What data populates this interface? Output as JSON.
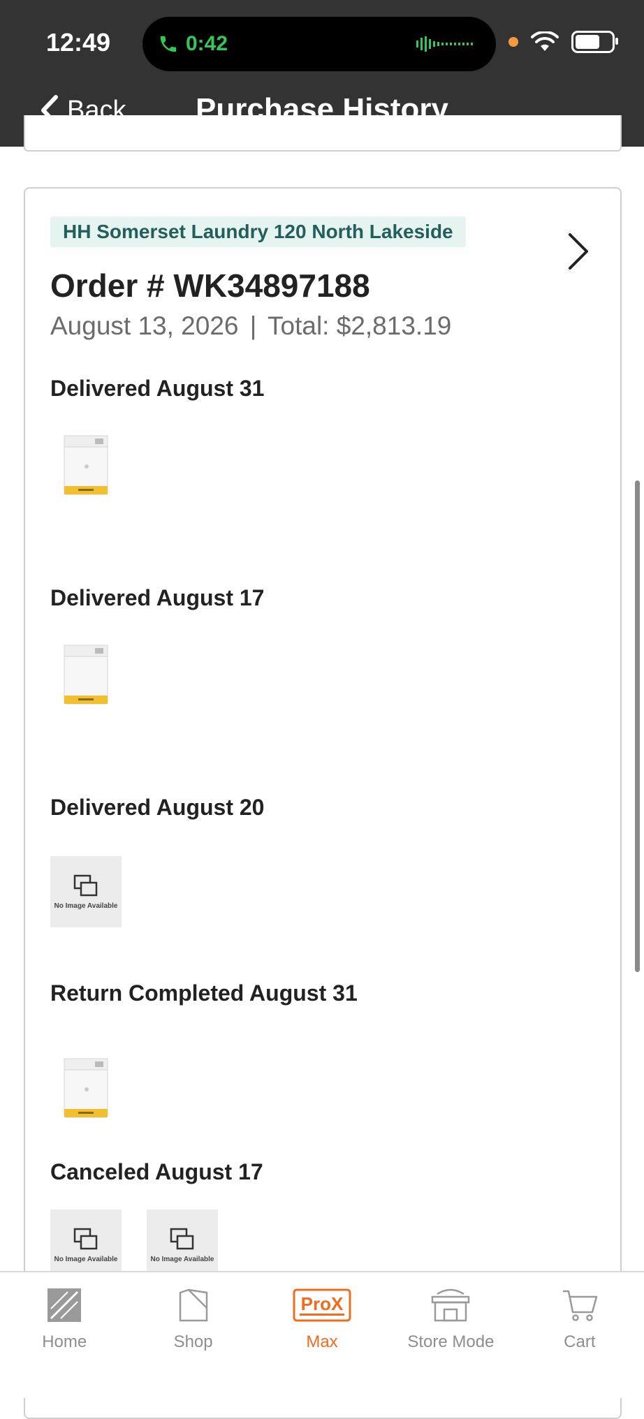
{
  "status_bar": {
    "time": "12:49",
    "call_timer": "0:42"
  },
  "header": {
    "back_label": "Back",
    "title": "Purchase History"
  },
  "order": {
    "store_tag": "HH Somerset Laundry 120 North Lakeside",
    "order_number": "Order # WK34897188",
    "date": "August 13, 2026",
    "separator": "|",
    "total": "Total: $2,813.19",
    "groups": [
      {
        "title": "Delivered August 31",
        "items": [
          "washer-image"
        ]
      },
      {
        "title": "Delivered August 17",
        "items": [
          "washer-image"
        ]
      },
      {
        "title": "Delivered August 20",
        "items": [
          "no-image"
        ]
      },
      {
        "title": "Return Completed August 31",
        "items": [
          "washer-image"
        ]
      },
      {
        "title": "Canceled August 17",
        "items": [
          "no-image",
          "no-image"
        ]
      }
    ],
    "no_image_label": "No Image Available"
  },
  "bottom_nav": {
    "items": [
      {
        "label": "Home",
        "icon": "home-depot-logo-icon",
        "active": false
      },
      {
        "label": "Shop",
        "icon": "shop-icon",
        "active": false
      },
      {
        "label": "Max",
        "icon": "prox-icon",
        "active": true
      },
      {
        "label": "Store Mode",
        "icon": "store-icon",
        "active": false
      },
      {
        "label": "Cart",
        "icon": "cart-icon",
        "active": false
      }
    ],
    "active_color": "#f06c1e",
    "inactive_color": "#8e8e8e"
  }
}
